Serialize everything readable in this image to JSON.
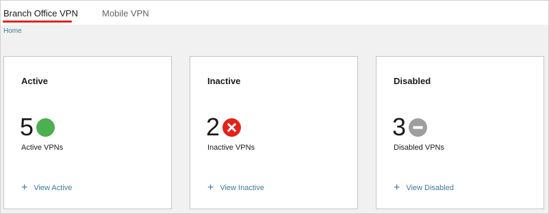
{
  "tabs": [
    {
      "label": "Branch Office VPN",
      "active": true
    },
    {
      "label": "Mobile VPN",
      "active": false
    }
  ],
  "breadcrumb": {
    "home_label": "Home"
  },
  "colors": {
    "accent": "#e2231a",
    "link": "#3d7a99",
    "active_status": "#4caf50",
    "inactive_status": "#e2231a",
    "disabled_status": "#9e9e9e"
  },
  "cards": [
    {
      "title": "Active",
      "count": "5",
      "subtitle": "Active VPNs",
      "link_label": "View Active",
      "icon": "check-circle-icon"
    },
    {
      "title": "Inactive",
      "count": "2",
      "subtitle": "Inactive VPNs",
      "link_label": "View Inactive",
      "icon": "x-circle-icon"
    },
    {
      "title": "Disabled",
      "count": "3",
      "subtitle": "Disabled VPNs",
      "link_label": "View Disabled",
      "icon": "minus-circle-icon"
    }
  ]
}
